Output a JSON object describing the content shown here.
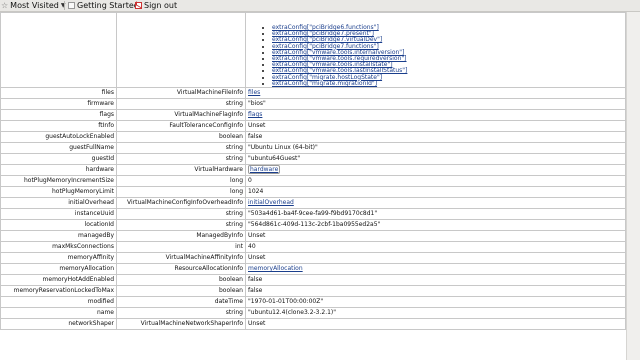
{
  "bookmarks": {
    "most_visited": "Most Visited",
    "getting_started": "Getting Started",
    "sign_out": "Sign out"
  },
  "config_entries": [
    "extraConfig[\"pciBridge6.functions\"]",
    "extraConfig[\"pciBridge7.present\"]",
    "extraConfig[\"pciBridge7.virtualDev\"]",
    "extraConfig[\"pciBridge7.functions\"]",
    "extraConfig[\"vmware.tools.internalversion\"]",
    "extraConfig[\"vmware.tools.requiredversion\"]",
    "extraConfig[\"vmware.tools.installstate\"]",
    "extraConfig[\"vmware.tools.lastInstallStatus\"]",
    "extraConfig[\"migrate.hostLogState\"]",
    "extraConfig[\"migrate.migrationId\"]"
  ],
  "rows": [
    {
      "name": "files",
      "type": "VirtualMachineFileInfo",
      "value": "files",
      "link": true
    },
    {
      "name": "firmware",
      "type": "string",
      "value": "\"bios\""
    },
    {
      "name": "flags",
      "type": "VirtualMachineFlagInfo",
      "value": "flags",
      "link": true
    },
    {
      "name": "ftInfo",
      "type": "FaultToleranceConfigInfo",
      "value": "Unset"
    },
    {
      "name": "guestAutoLockEnabled",
      "type": "boolean",
      "value": "false"
    },
    {
      "name": "guestFullName",
      "type": "string",
      "value": "\"Ubuntu Linux (64-bit)\""
    },
    {
      "name": "guestId",
      "type": "string",
      "value": "\"ubuntu64Guest\""
    },
    {
      "name": "hardware",
      "type": "VirtualHardware",
      "value": "hardware",
      "link": true,
      "hover": true
    },
    {
      "name": "hotPlugMemoryIncrementSize",
      "type": "long",
      "value": "0"
    },
    {
      "name": "hotPlugMemoryLimit",
      "type": "long",
      "value": "1024"
    },
    {
      "name": "initialOverhead",
      "type": "VirtualMachineConfigInfoOverheadInfo",
      "value": "initialOverhead",
      "link": true
    },
    {
      "name": "instanceUuid",
      "type": "string",
      "value": "\"503a4d61-ba4f-9cee-fa99-f9bd9170c8d1\""
    },
    {
      "name": "locationId",
      "type": "string",
      "value": "\"564d861c-409d-113c-2cbf-1ba0955ed2a5\""
    },
    {
      "name": "managedBy",
      "type": "ManagedByInfo",
      "value": "Unset"
    },
    {
      "name": "maxMksConnections",
      "type": "int",
      "value": "40"
    },
    {
      "name": "memoryAffinity",
      "type": "VirtualMachineAffinityInfo",
      "value": "Unset"
    },
    {
      "name": "memoryAllocation",
      "type": "ResourceAllocationInfo",
      "value": "memoryAllocation",
      "link": true
    },
    {
      "name": "memoryHotAddEnabled",
      "type": "boolean",
      "value": "false"
    },
    {
      "name": "memoryReservationLockedToMax",
      "type": "boolean",
      "value": "false"
    },
    {
      "name": "modified",
      "type": "dateTime",
      "value": "\"1970-01-01T00:00:00Z\""
    },
    {
      "name": "name",
      "type": "string",
      "value": "\"ubuntu12.4(clone3.2-3.2.1)\""
    },
    {
      "name": "networkShaper",
      "type": "VirtualMachineNetworkShaperInfo",
      "value": "Unset"
    }
  ]
}
